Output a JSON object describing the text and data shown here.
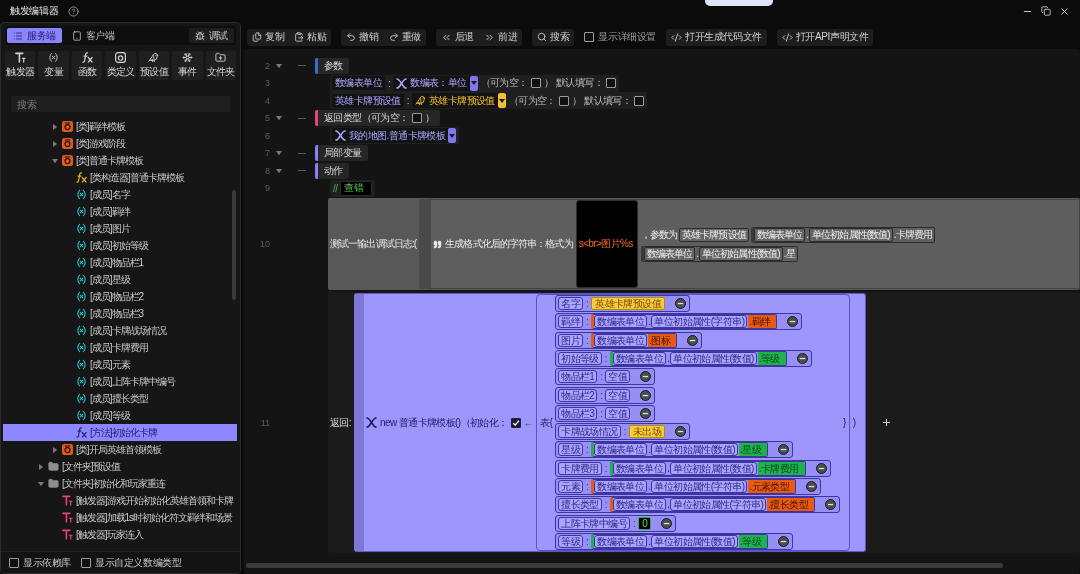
{
  "window": {
    "title": "触发编辑器"
  },
  "left_panel": {
    "tabs": [
      {
        "label": "服务端",
        "kind": "server",
        "selected": true
      },
      {
        "label": "客户端",
        "kind": "client",
        "selected": false
      }
    ],
    "debug_button": {
      "label": "调试"
    },
    "tools": [
      {
        "label": "触发器",
        "kind": "trigger"
      },
      {
        "label": "变量",
        "kind": "variable"
      },
      {
        "label": "函数",
        "kind": "function"
      },
      {
        "label": "类定义",
        "kind": "class"
      },
      {
        "label": "预设值",
        "kind": "preset"
      },
      {
        "label": "事件",
        "kind": "event"
      },
      {
        "label": "文件夹",
        "kind": "folder"
      }
    ],
    "search": {
      "placeholder": "搜索"
    },
    "tree": [
      {
        "children": [
          {
            "label": "[类]羁绊模板",
            "kind": "class",
            "expanded": false,
            "selected": false
          },
          {
            "label": "[类]游戏阶段",
            "kind": "class",
            "expanded": false,
            "selected": false
          },
          {
            "label": "[类]普通卡牌模板",
            "kind": "class",
            "expanded": true,
            "selected": false,
            "children": [
              {
                "label": "[类构造器]普通卡牌模板",
                "kind": "constructor",
                "selected": false
              },
              {
                "label": "[成员]名字",
                "kind": "member",
                "selected": false
              },
              {
                "label": "[成员]羁绊",
                "kind": "member",
                "selected": false
              },
              {
                "label": "[成员]图片",
                "kind": "member",
                "selected": false
              },
              {
                "label": "[成员]初始等级",
                "kind": "member",
                "selected": false
              },
              {
                "label": "[成员]物品栏1",
                "kind": "member",
                "selected": false
              },
              {
                "label": "[成员]星级",
                "kind": "member",
                "selected": false
              },
              {
                "label": "[成员]物品栏2",
                "kind": "member",
                "selected": false
              },
              {
                "label": "[成员]物品栏3",
                "kind": "member",
                "selected": false
              },
              {
                "label": "[成员]卡牌战场情况",
                "kind": "member",
                "selected": false
              },
              {
                "label": "[成员]卡牌费用",
                "kind": "member",
                "selected": false
              },
              {
                "label": "[成员]元素",
                "kind": "member",
                "selected": false
              },
              {
                "label": "[成员]上阵卡牌中编号",
                "kind": "member",
                "selected": false
              },
              {
                "label": "[成员]擅长类型",
                "kind": "member",
                "selected": false
              },
              {
                "label": "[成员]等级",
                "kind": "member",
                "selected": false
              },
              {
                "label": "[方法]初始化卡牌",
                "kind": "method",
                "selected": true
              }
            ]
          },
          {
            "label": "[类]开局英雄首领模板",
            "kind": "class",
            "expanded": false,
            "selected": false
          }
        ]
      },
      {
        "label": "[文件夹]预设值",
        "kind": "folder",
        "expanded": false,
        "selected": false
      },
      {
        "label": "[文件夹]初始化和玩家重连",
        "kind": "folder",
        "expanded": true,
        "selected": false,
        "children": [
          {
            "label": "[触发器]游戏开始初始化英雄首领和卡牌",
            "kind": "trigger",
            "selected": false
          },
          {
            "label": "[触发器]加载1s时初始化符文羁绊和场景",
            "kind": "trigger",
            "selected": false
          },
          {
            "label": "[触发器]玩家连入",
            "kind": "trigger",
            "selected": false
          }
        ]
      }
    ],
    "options": [
      {
        "label": "显示依赖库",
        "checked": false
      },
      {
        "label": "显示自定义数编类型",
        "checked": false
      }
    ]
  },
  "toolbar": [
    {
      "kind": "group",
      "buttons": [
        {
          "label": "复制",
          "kind": "copy"
        },
        {
          "label": "粘贴",
          "kind": "paste"
        }
      ]
    },
    {
      "kind": "group",
      "buttons": [
        {
          "label": "撤销",
          "kind": "undo"
        },
        {
          "label": "重做",
          "kind": "redo"
        }
      ]
    },
    {
      "kind": "group",
      "buttons": [
        {
          "label": "后退",
          "kind": "back"
        },
        {
          "label": "前进",
          "kind": "forward"
        }
      ]
    },
    {
      "kind": "search",
      "label": "搜索"
    },
    {
      "kind": "checkbox",
      "label": "显示详细设置",
      "checked": false
    },
    {
      "kind": "code",
      "label": "打开生成代码文件"
    },
    {
      "kind": "code",
      "label": "打开API声明文件"
    }
  ],
  "editor": {
    "lines": [
      {
        "number": "2",
        "kind": "section",
        "expanded": true,
        "label": "参数",
        "color": "#2f6fd0"
      },
      {
        "number": "3",
        "kind": "param",
        "name": "数编表单位",
        "colon": ":",
        "type": {
          "label": "数编表：单位",
          "kind": "unit"
        },
        "nullable_label": "（可为空：",
        "nullable": false,
        "close": "）",
        "default_label": "默认填写：",
        "default": false
      },
      {
        "number": "4",
        "kind": "param",
        "name": "英雄卡牌预设值",
        "colon": ":",
        "type": {
          "label": "英雄卡牌预设值",
          "kind": "preset"
        },
        "nullable_label": "（可为空：",
        "nullable": false,
        "close": "）",
        "default_label": "默认填写：",
        "default": false
      },
      {
        "number": "5",
        "kind": "section",
        "expanded": true,
        "label": "返回类型（可为空：",
        "checked": false,
        "close": "）",
        "color": "#e2457c"
      },
      {
        "number": "6",
        "kind": "type",
        "type": {
          "label": "我的地图.普通卡牌模板",
          "kind": "unit"
        }
      },
      {
        "number": "7",
        "kind": "section",
        "expanded": true,
        "label": "局部变量",
        "color": "#8b80f9"
      },
      {
        "number": "8",
        "kind": "section",
        "expanded": true,
        "label": "动作",
        "color": "#8b80f9"
      },
      {
        "number": "9",
        "kind": "comment",
        "mark": "//",
        "text": "查错"
      },
      {
        "number": "10",
        "kind": "log",
        "label": "测试一输出调试日志:(",
        "format_label": "生成格式化后的字符串：格式为",
        "format": "s<br>图片%s",
        "args_label": "，参数为",
        "args": [
          {
            "kind": "ref",
            "text": "英雄卡牌预设值"
          },
          {
            "kind": "property",
            "source": "数编表单位",
            "dot": ".",
            "attribute": "单位初始属性(数值)",
            "field": ".卡牌费用"
          },
          {
            "kind": "property",
            "source": "数编表单位",
            "dot": ".",
            "attribute": "单位初始属性(数值)",
            "field": ".星"
          }
        ]
      },
      {
        "number": "11",
        "kind": "return",
        "label": "返回:",
        "call": "new 普通卡牌模板()（初始化：",
        "init_checked": true,
        "arrow": "←",
        "table_open": "表{",
        "table_close": "}",
        "close": ")",
        "fields": [
          {
            "name": "名字",
            "colon": ":",
            "value": {
              "kind": "preset",
              "text": "英雄卡牌预设值"
            }
          },
          {
            "name": "羁绊",
            "colon": ":",
            "value": {
              "kind": "string",
              "source": "数编表单位",
              "dot": ".",
              "attribute": "单位初始属性(字符串)",
              "field": ".羁绊"
            }
          },
          {
            "name": "图片",
            "colon": ":",
            "value": {
              "kind": "string",
              "source": "数编表单位",
              "field": ".图标"
            }
          },
          {
            "name": "初始等级",
            "colon": ":",
            "value": {
              "kind": "number",
              "source": "数编表单位",
              "dot": ".",
              "attribute": "单位初始属性(数值)",
              "field": ".等级"
            }
          },
          {
            "name": "物品栏1",
            "colon": ":",
            "value": {
              "kind": "empty",
              "text": "空值"
            }
          },
          {
            "name": "物品栏2",
            "colon": ":",
            "value": {
              "kind": "empty",
              "text": "空值"
            }
          },
          {
            "name": "物品栏3",
            "colon": ":",
            "value": {
              "kind": "empty",
              "text": "空值"
            }
          },
          {
            "name": "卡牌战场情况",
            "colon": ":",
            "value": {
              "kind": "preset",
              "text": "未出场"
            }
          },
          {
            "name": "星级",
            "colon": ":",
            "value": {
              "kind": "number",
              "source": "数编表单位",
              "dot": ".",
              "attribute": "单位初始属性(数值)",
              "field": ".星级"
            }
          },
          {
            "name": "卡牌费用",
            "colon": ":",
            "value": {
              "kind": "number",
              "source": "数编表单位",
              "dot": ".",
              "attribute": "单位初始属性(数值)",
              "field": ".卡牌费用"
            }
          },
          {
            "name": "元素",
            "colon": ":",
            "value": {
              "kind": "string",
              "source": "数编表单位",
              "dot": ".",
              "attribute": "单位初始属性(字符串)",
              "field": ".元素类型"
            }
          },
          {
            "name": "擅长类型",
            "colon": ":",
            "value": {
              "kind": "string",
              "source": "数编表单位",
              "dot": ".",
              "attribute": "单位初始属性(字符串)",
              "field": ".擅长类型"
            }
          },
          {
            "name": "上阵卡牌中编号",
            "colon": ":",
            "value": {
              "kind": "constant",
              "text": "0"
            }
          },
          {
            "name": "等级",
            "colon": ":",
            "value": {
              "kind": "number",
              "source": "数编表单位",
              "dot": ".",
              "attribute": "单位初始属性(数值)",
              "field": ".等级"
            }
          }
        ]
      }
    ]
  }
}
